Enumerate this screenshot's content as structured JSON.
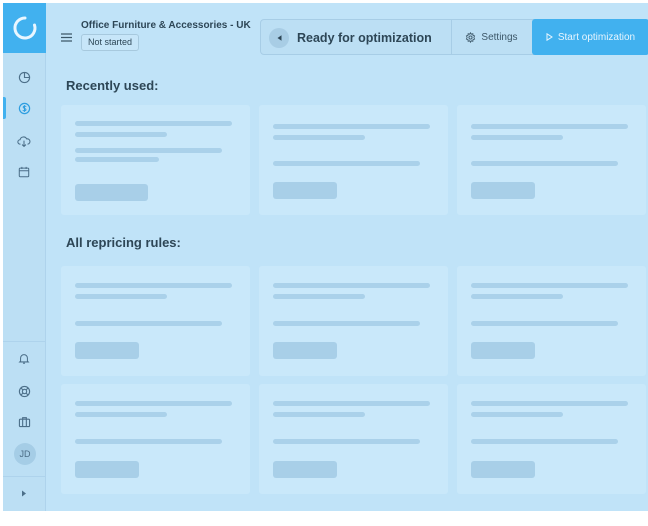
{
  "header": {
    "store_name": "Office Furniture & Accessories - UK",
    "status": "Not started",
    "action_title": "Ready for optimization",
    "settings_label": "Settings",
    "start_label": "Start optimization"
  },
  "sidebar": {
    "items": [
      {
        "icon": "pie-chart-icon"
      },
      {
        "icon": "pricing-icon",
        "active": true
      },
      {
        "icon": "cloud-download-icon"
      },
      {
        "icon": "calendar-icon"
      }
    ],
    "bottom_items": [
      {
        "icon": "bell-icon"
      },
      {
        "icon": "help-lifebuoy-icon"
      },
      {
        "icon": "briefcase-icon"
      }
    ],
    "user_initials": "JD"
  },
  "sections": {
    "recently_used": "Recently used:",
    "all_rules": "All repricing rules:"
  },
  "colors": {
    "accent": "#41b1ef",
    "background": "#c0e3f8",
    "card": "#c9e8fa",
    "placeholder": "#aad1ea"
  }
}
